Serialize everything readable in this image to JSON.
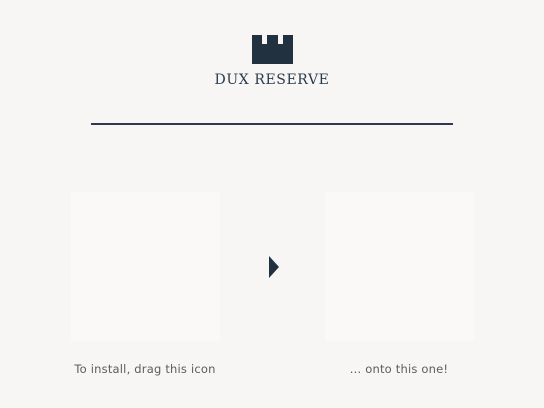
{
  "header": {
    "logo_icon": "castle-tower-icon",
    "brand_name": "DUX RESERVE"
  },
  "installer": {
    "source_caption": "To install, drag this icon",
    "target_caption": "... onto this one!",
    "arrow_icon": "arrow-right-icon"
  },
  "colors": {
    "background": "#f7f6f4",
    "brand": "#213140",
    "divider": "#2d3b4d",
    "caption_text": "#5c5c5c",
    "drop_box": "#faf9f7"
  }
}
